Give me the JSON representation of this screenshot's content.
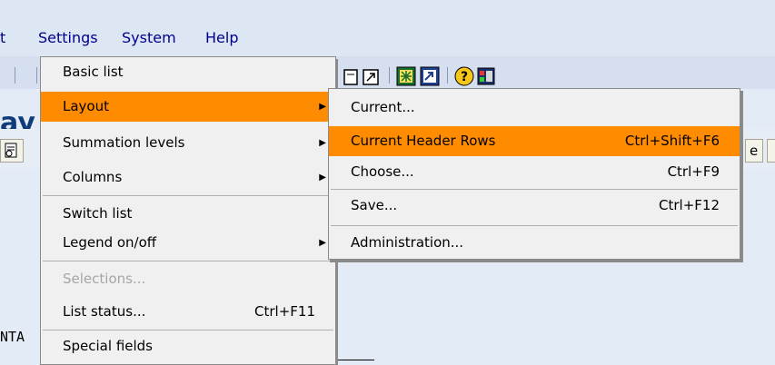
{
  "menubar": {
    "items": [
      {
        "label": "t"
      },
      {
        "label": "Settings"
      },
      {
        "label": "System"
      },
      {
        "label": "Help"
      }
    ]
  },
  "title_fragment": "ay",
  "list_fragment": "NTA",
  "app_toolbar": {
    "right_fragment": "e"
  },
  "settings_menu": {
    "items": [
      {
        "label": "Basic list",
        "shortcut": "",
        "submenu": false,
        "disabled": false,
        "highlighted": false
      },
      {
        "label": "Layout",
        "shortcut": "",
        "submenu": true,
        "disabled": false,
        "highlighted": true
      },
      {
        "label": "Summation levels",
        "shortcut": "",
        "submenu": true,
        "disabled": false,
        "highlighted": false
      },
      {
        "label": "Columns",
        "shortcut": "",
        "submenu": true,
        "disabled": false,
        "highlighted": false
      },
      {
        "label": "Switch list",
        "shortcut": "",
        "submenu": false,
        "disabled": false,
        "highlighted": false
      },
      {
        "label": "Legend on/off",
        "shortcut": "",
        "submenu": true,
        "disabled": false,
        "highlighted": false
      },
      {
        "label": "Selections...",
        "shortcut": "",
        "submenu": false,
        "disabled": true,
        "highlighted": false
      },
      {
        "label": "List status...",
        "shortcut": "Ctrl+F11",
        "submenu": false,
        "disabled": false,
        "highlighted": false
      },
      {
        "label": "Special fields",
        "shortcut": "",
        "submenu": false,
        "disabled": false,
        "highlighted": false
      }
    ]
  },
  "layout_submenu": {
    "items": [
      {
        "label": "Current...",
        "shortcut": "",
        "highlighted": false
      },
      {
        "label": "Current Header Rows",
        "shortcut": "Ctrl+Shift+F6",
        "highlighted": true
      },
      {
        "label": "Choose...",
        "shortcut": "Ctrl+F9",
        "highlighted": false
      },
      {
        "label": "Save...",
        "shortcut": "Ctrl+F12",
        "highlighted": false
      },
      {
        "label": "Administration...",
        "shortcut": "",
        "highlighted": false
      }
    ]
  },
  "colors": {
    "highlight": "#ff8c00",
    "menubar_text": "#00008b",
    "menu_bg": "#f0f0f0",
    "title_text": "#0f3b7a"
  },
  "icons": [
    "create-session-icon",
    "shortcut-icon",
    "layout-grid-icon",
    "graphic-icon",
    "help-icon",
    "customize-icon"
  ]
}
